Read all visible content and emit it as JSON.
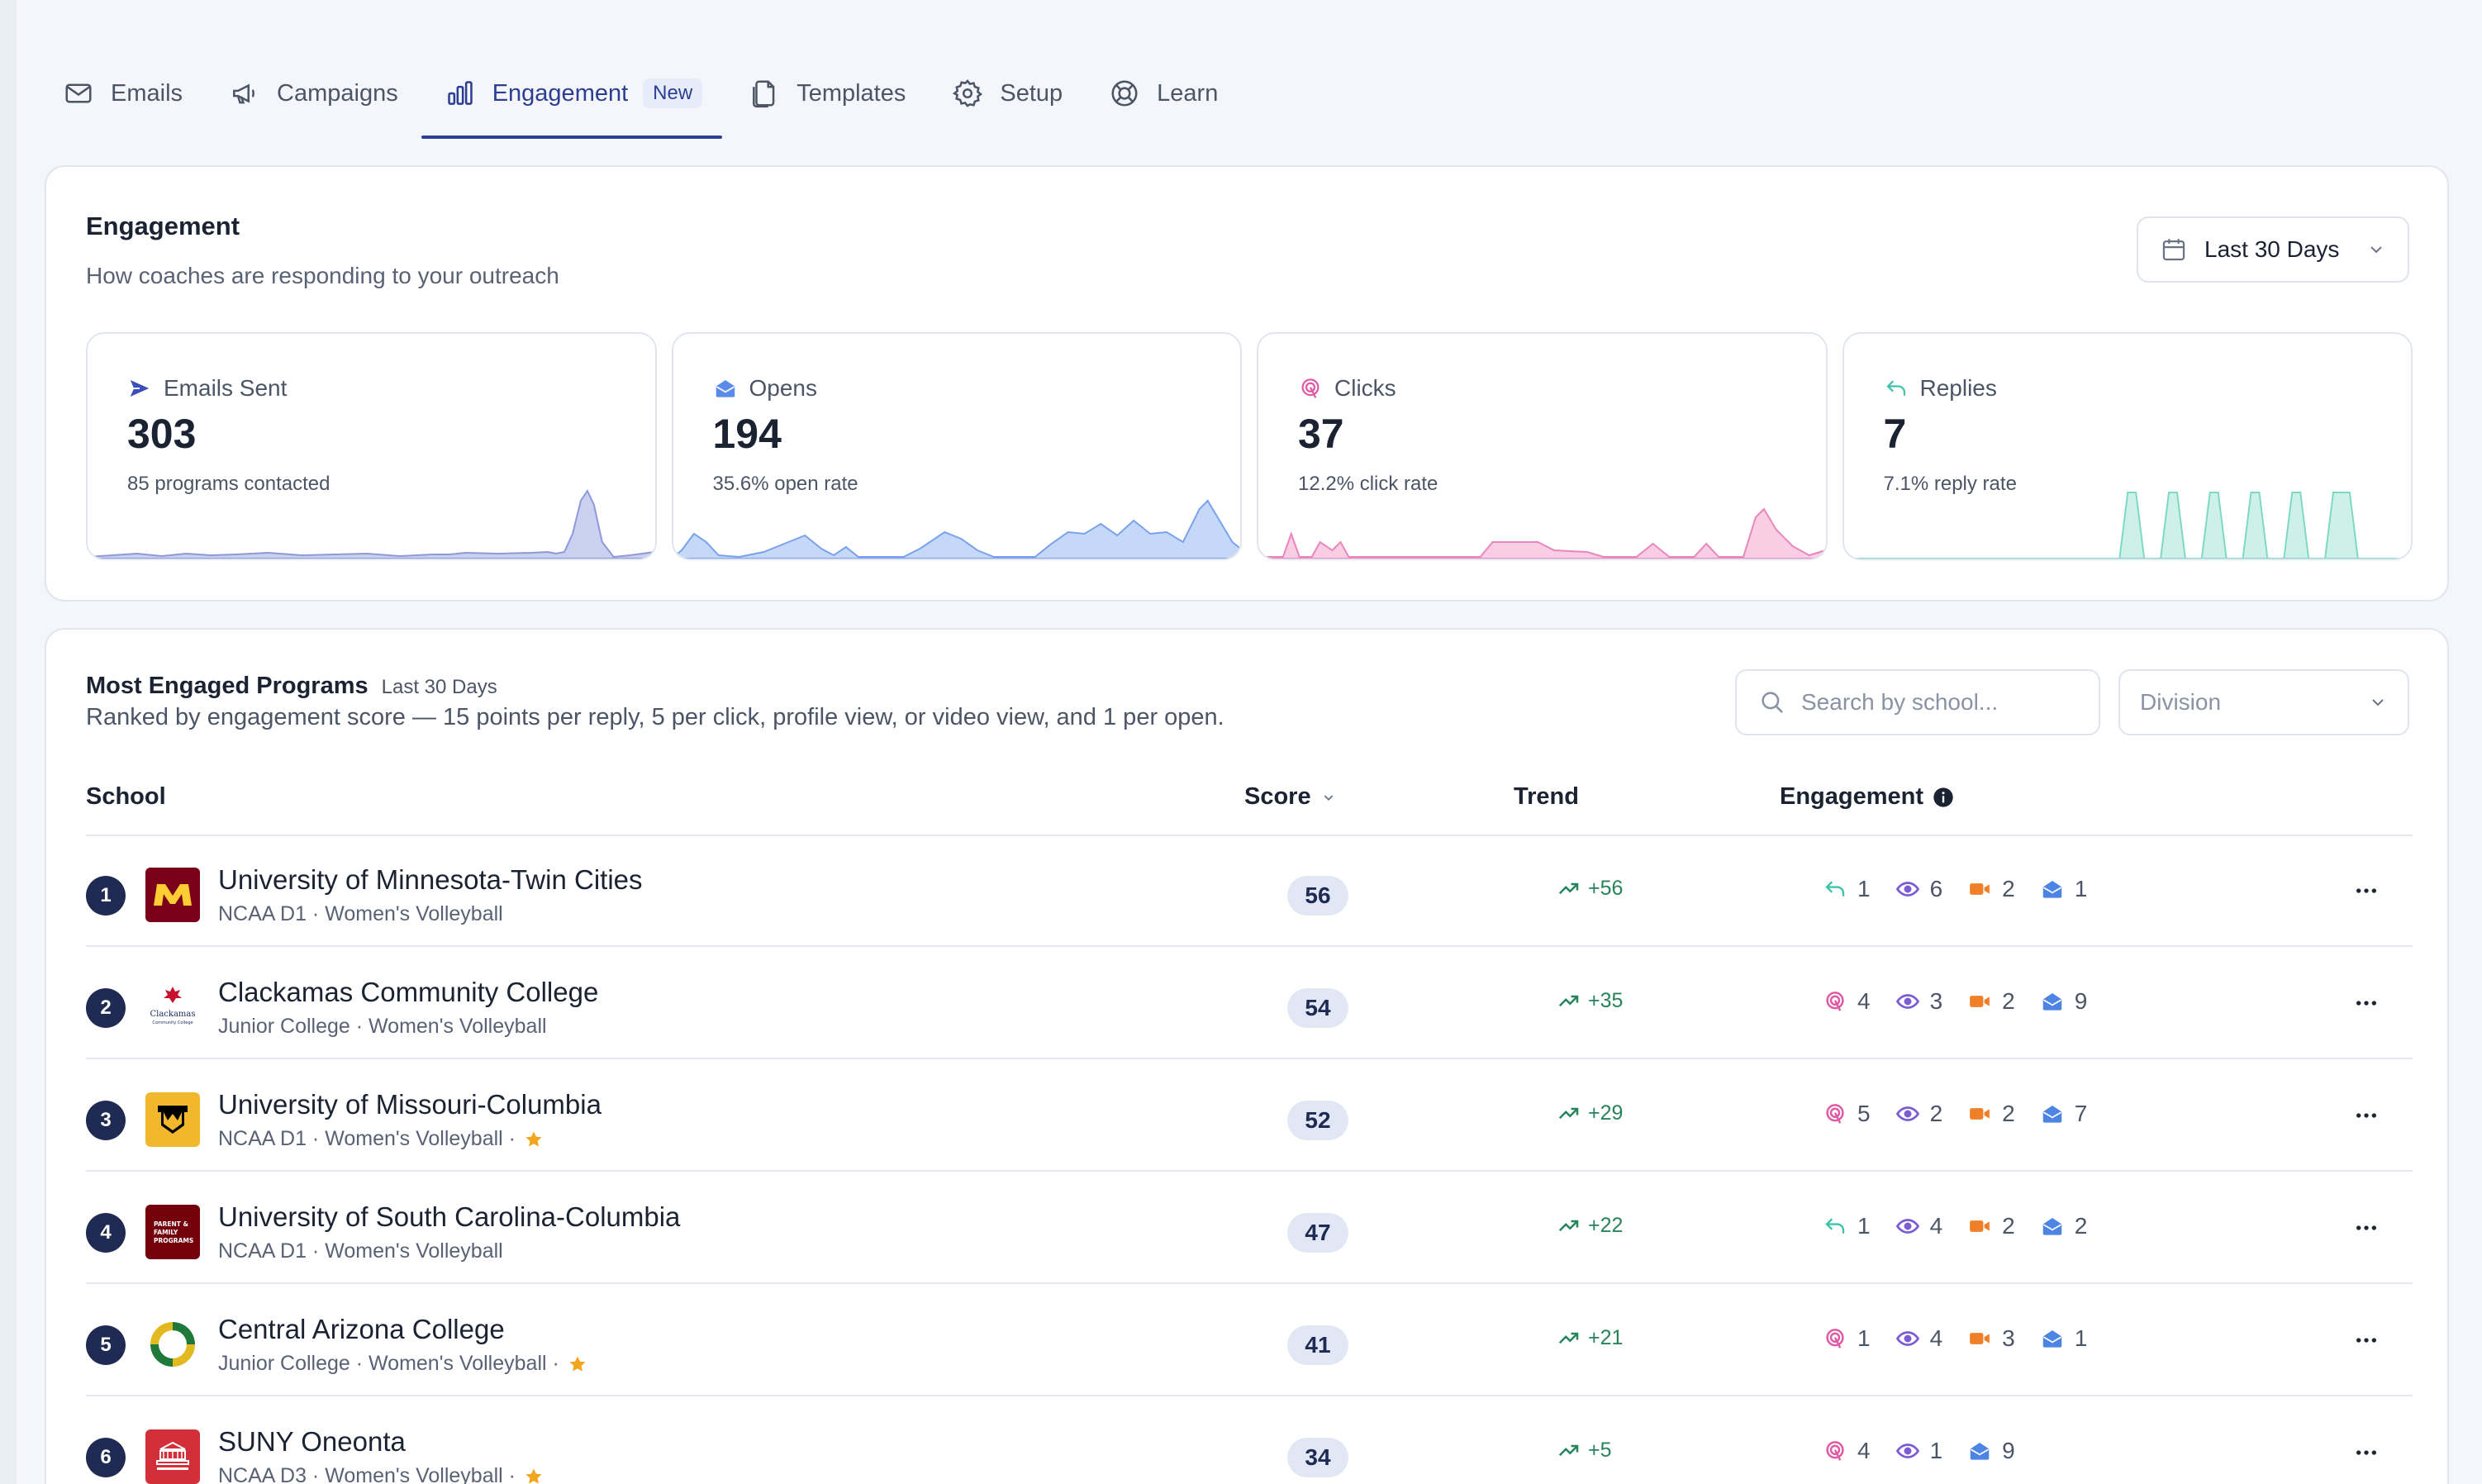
{
  "nav": {
    "tabs": [
      {
        "label": "Emails",
        "icon": "mail-icon"
      },
      {
        "label": "Campaigns",
        "icon": "megaphone-icon"
      },
      {
        "label": "Engagement",
        "icon": "bar-chart-icon",
        "badge": "New",
        "active": true
      },
      {
        "label": "Templates",
        "icon": "document-icon"
      },
      {
        "label": "Setup",
        "icon": "gear-icon"
      },
      {
        "label": "Learn",
        "icon": "lifebuoy-icon"
      }
    ]
  },
  "engagement": {
    "title": "Engagement",
    "subtitle": "How coaches are responding to your outreach",
    "range_label": "Last 30 Days",
    "stats": [
      {
        "label": "Emails Sent",
        "value": "303",
        "sub": "85 programs contacted",
        "icon": "send-icon",
        "color": "#3a4fb8"
      },
      {
        "label": "Opens",
        "value": "194",
        "sub": "35.6% open rate",
        "icon": "open-envelope-icon",
        "color": "#5a8be8"
      },
      {
        "label": "Clicks",
        "value": "37",
        "sub": "12.2% click rate",
        "icon": "click-icon",
        "color": "#e05aa5"
      },
      {
        "label": "Replies",
        "value": "7",
        "sub": "7.1% reply rate",
        "icon": "reply-icon",
        "color": "#3fc3a8"
      }
    ]
  },
  "programs": {
    "title": "Most Engaged Programs",
    "range": "Last 30 Days",
    "description": "Ranked by engagement score — 15 points per reply, 5 per click, profile view, or video view, and 1 per open.",
    "search_placeholder": "Search by school...",
    "division_placeholder": "Division",
    "columns": {
      "school": "School",
      "score": "Score",
      "trend": "Trend",
      "engagement": "Engagement"
    },
    "rows": [
      {
        "rank": "1",
        "name": "University of Minnesota-Twin Cities",
        "meta": "NCAA D1 · Women's Volleyball",
        "star": false,
        "score": "56",
        "trend": "+56",
        "engagement": [
          {
            "icon": "reply-icon",
            "count": "1"
          },
          {
            "icon": "eye-icon",
            "count": "6"
          },
          {
            "icon": "video-icon",
            "count": "2"
          },
          {
            "icon": "open-envelope-icon",
            "count": "1"
          }
        ]
      },
      {
        "rank": "2",
        "name": "Clackamas Community College",
        "meta": "Junior College · Women's Volleyball",
        "star": false,
        "score": "54",
        "trend": "+35",
        "engagement": [
          {
            "icon": "click-icon",
            "count": "4"
          },
          {
            "icon": "eye-icon",
            "count": "3"
          },
          {
            "icon": "video-icon",
            "count": "2"
          },
          {
            "icon": "open-envelope-icon",
            "count": "9"
          }
        ]
      },
      {
        "rank": "3",
        "name": "University of Missouri-Columbia",
        "meta": "NCAA D1 · Women's Volleyball ·",
        "star": true,
        "score": "52",
        "trend": "+29",
        "engagement": [
          {
            "icon": "click-icon",
            "count": "5"
          },
          {
            "icon": "eye-icon",
            "count": "2"
          },
          {
            "icon": "video-icon",
            "count": "2"
          },
          {
            "icon": "open-envelope-icon",
            "count": "7"
          }
        ]
      },
      {
        "rank": "4",
        "name": "University of South Carolina-Columbia",
        "meta": "NCAA D1 · Women's Volleyball",
        "star": false,
        "score": "47",
        "trend": "+22",
        "engagement": [
          {
            "icon": "reply-icon",
            "count": "1"
          },
          {
            "icon": "eye-icon",
            "count": "4"
          },
          {
            "icon": "video-icon",
            "count": "2"
          },
          {
            "icon": "open-envelope-icon",
            "count": "2"
          }
        ]
      },
      {
        "rank": "5",
        "name": "Central Arizona College",
        "meta": "Junior College · Women's Volleyball ·",
        "star": true,
        "score": "41",
        "trend": "+21",
        "engagement": [
          {
            "icon": "click-icon",
            "count": "1"
          },
          {
            "icon": "eye-icon",
            "count": "4"
          },
          {
            "icon": "video-icon",
            "count": "3"
          },
          {
            "icon": "open-envelope-icon",
            "count": "1"
          }
        ]
      },
      {
        "rank": "6",
        "name": "SUNY Oneonta",
        "meta": "NCAA D3 · Women's Volleyball ·",
        "star": true,
        "score": "34",
        "trend": "+5",
        "engagement": [
          {
            "icon": "click-icon",
            "count": "4"
          },
          {
            "icon": "eye-icon",
            "count": "1"
          },
          {
            "icon": "open-envelope-icon",
            "count": "9"
          }
        ]
      }
    ]
  },
  "logos": {
    "minnesota": {
      "text": "M",
      "bg": "#7a0019",
      "fg": "#ffcc33"
    },
    "clackamas": {
      "text": "Clackamas",
      "sub": "Community College"
    },
    "missouri": {
      "text": "M",
      "bg": "#f1b82d",
      "fg": "#000000"
    },
    "south_carolina": {
      "text": "PARENT & FAMILY PROGRAMS",
      "bg": "#73000a",
      "fg": "#ffffff"
    },
    "central_arizona": {},
    "suny_oneonta": {
      "bg": "#d32f3a"
    }
  }
}
